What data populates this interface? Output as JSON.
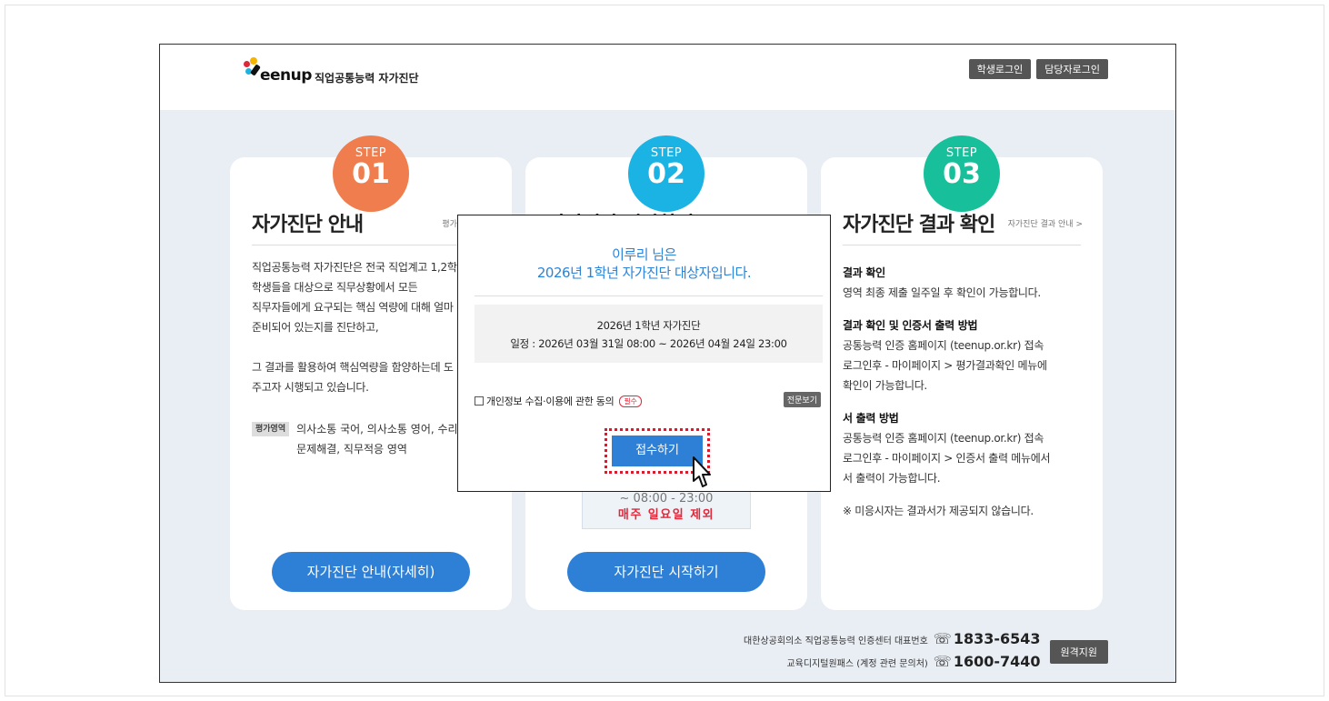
{
  "header": {
    "logo_word": "eenup",
    "logo_sub": "직업공통능력 자가진단",
    "student_login": "학생로그인",
    "manager_login": "담당자로그인"
  },
  "colors": {
    "step1": "#ef7d4d",
    "step2": "#1ab3e3",
    "step3": "#17c09a",
    "primary": "#2e7fd6",
    "accent_red": "#e0283b"
  },
  "cards": [
    {
      "step_label": "STEP",
      "step_num": "01",
      "title": "자가진단 안내",
      "link": "평가 메뉴얼 >",
      "body": [
        "직업공통능력 자가진단은 전국 직업계고 1,2학",
        "학생들을 대상으로 직무상황에서 모든",
        "직무자들에게 요구되는 핵심 역량에 대해 얼마",
        "준비되어 있는지를 진단하고,",
        "",
        "그 결과를 활용하여 핵심역량을 함양하는데 도",
        "주고자 시행되고 있습니다."
      ],
      "area_badge": "평가영역",
      "area_lines": [
        "의사소통 국어, 의사소통 영어, 수리",
        "문제해결, 직무적응 영역"
      ],
      "button": "자가진단 안내(자세히)"
    },
    {
      "step_label": "STEP",
      "step_num": "02",
      "title": "자가진단 시작하기",
      "time_partial": "~ 08:00 - 23:00",
      "sunday": "매주 일요일 제외",
      "button": "자가진단 시작하기"
    },
    {
      "step_label": "STEP",
      "step_num": "03",
      "title": "자가진단 결과 확인",
      "link": "자가진단 결과 안내 >",
      "sections": [
        {
          "head": "결과 확인",
          "lines": [
            "영역 최종 제출 일주일 후 확인이 가능합니다."
          ]
        },
        {
          "head": "결과 확인 및 인증서 출력 방법",
          "lines": [
            "공통능력 인증 홈페이지 (teenup.or.kr) 접속",
            "로그인후 - 마이페이지 > 평가결과확인 메뉴에",
            "확인이 가능합니다."
          ]
        },
        {
          "head": "서 출력 방법",
          "lines": [
            "공통능력 인증 홈페이지 (teenup.or.kr) 접속",
            "로그인후 - 마이페이지 > 인증서 출력 메뉴에서",
            "서 출력이 가능합니다."
          ]
        }
      ],
      "note": "※ 미응시자는 결과서가 제공되지 않습니다."
    }
  ],
  "footer": {
    "line1": "대한상공회의소 직업공통능력 인증센터 대표번호",
    "phone1": "1833-6543",
    "line2": "교육디지털원패스 (계정 관련 문의처)",
    "phone2": "1600-7440",
    "remote": "원격지원"
  },
  "modal": {
    "title_line1": "이루리 님은",
    "title_line2": "2026년 1학년 자가진단 대상자입니다.",
    "info_line1": "2026년 1학년 자가진단",
    "info_line2": "일정 : 2026년 03월 31일 08:00 ~ 2026년 04월 24일 23:00",
    "consent": "개인정보 수집·이용에 관한 동의",
    "required": "필수",
    "full_text": "전문보기",
    "submit": "접수하기"
  }
}
